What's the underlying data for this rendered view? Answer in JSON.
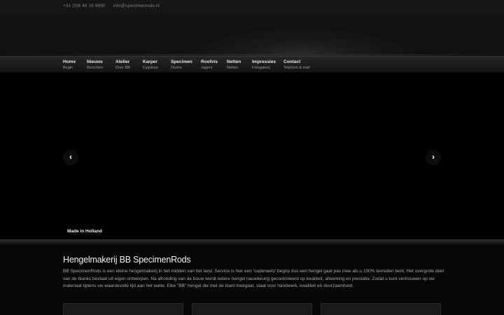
{
  "topbar": {
    "phone": "+31 (0)6 46 18 9650",
    "email": "info@specimenrods.nl"
  },
  "nav": {
    "items": [
      {
        "label": "Home",
        "sub": "Begin"
      },
      {
        "label": "Nieuws",
        "sub": "Berichten"
      },
      {
        "label": "Atelier",
        "sub": "Over BB"
      },
      {
        "label": "Karper",
        "sub": "Cyprinus"
      },
      {
        "label": "Specimen",
        "sub": "Divers"
      },
      {
        "label": "Roofvis",
        "sub": "Jagers"
      },
      {
        "label": "Netten",
        "sub": "Netten"
      },
      {
        "label": "Impressies",
        "sub": "Fotogalerij"
      },
      {
        "label": "Contact",
        "sub": "Telefoon & mail"
      }
    ]
  },
  "slider": {
    "caption": "Made in Holland",
    "prev_icon": "chevron-left-icon",
    "next_icon": "chevron-right-icon"
  },
  "intro": {
    "title": "Hengelmakerij BB SpecimenRods",
    "text": "BB SpecimenRods is een kleine hengelmakerij in het midden van het land. Service is hier een 'ouderwets' begrip dus een hengel gaat pas mee als u 100% tevreden bent. Het overgrote deel van de blanks bestaat uit eigen ontwerpen. Na afronding van de bouw wordt iedere hengel nauwkeurig gecontroleerd op kwaliteit, afwerking en prestatie. Zodat u kunt  vertrouwen op uw materiaal tijdens uw waardevolle tijd aan het water. Elke \"BB\" hengel die met de klant meegaat, staat voor handwerk, kwaliteit en duurzaamheid."
  }
}
